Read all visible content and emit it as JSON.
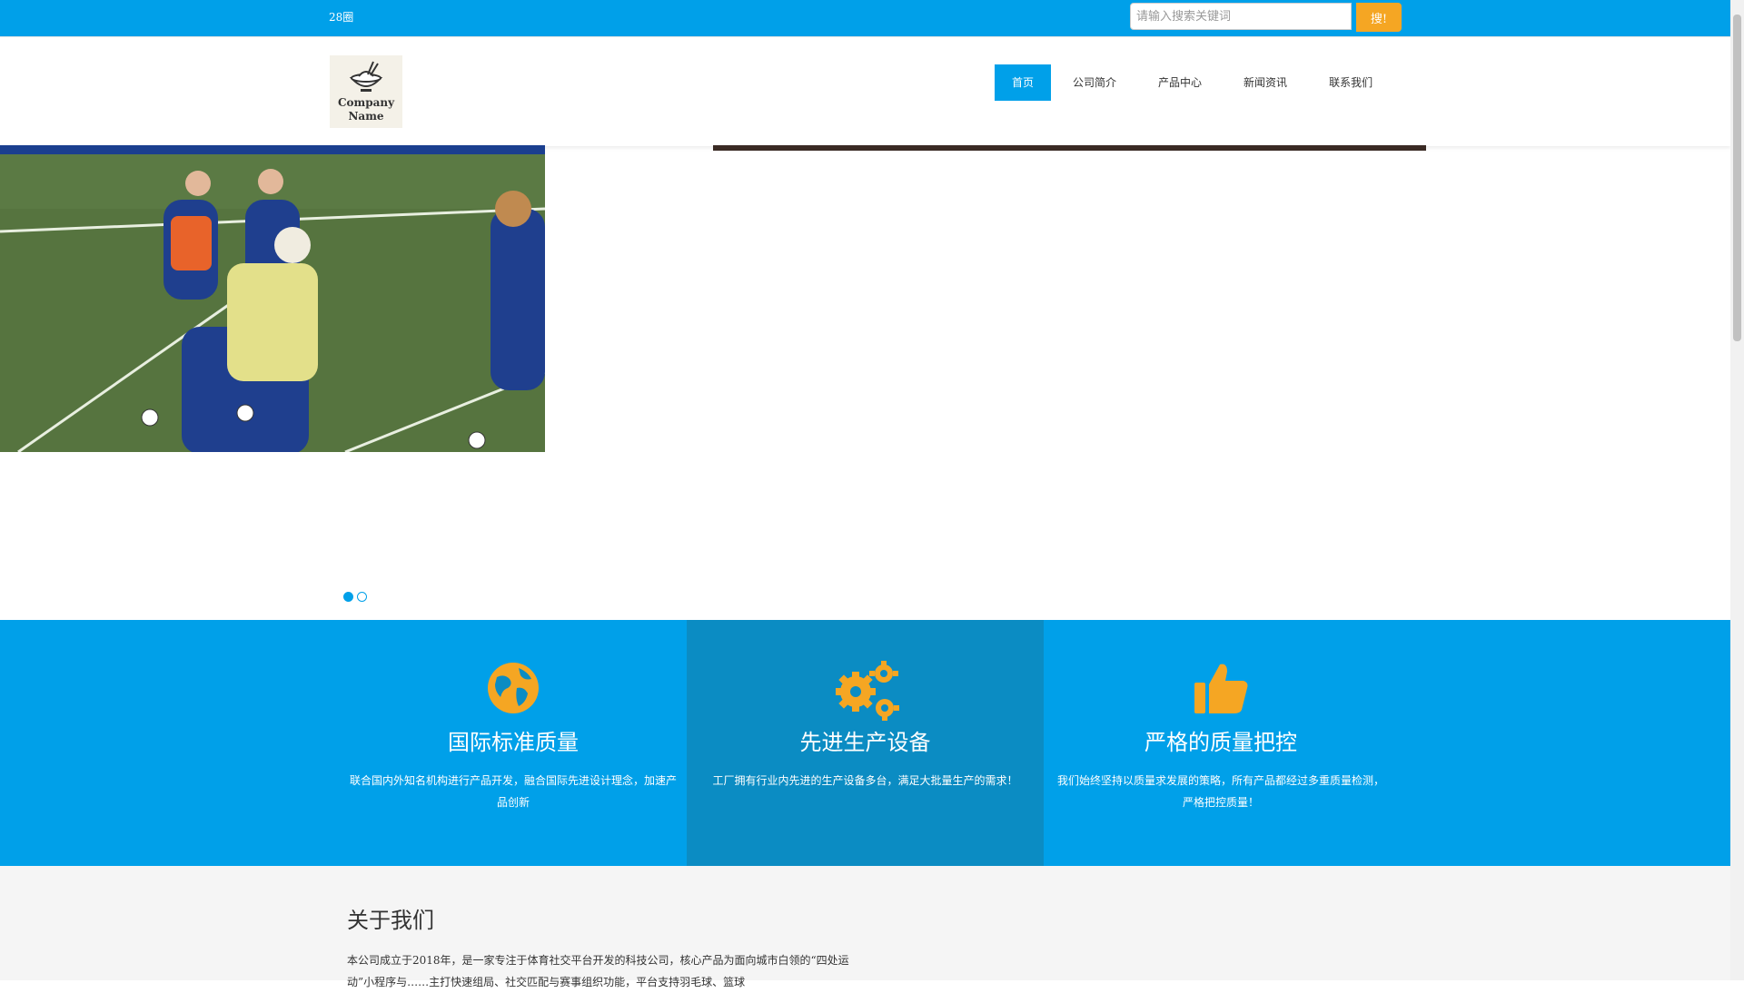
{
  "topbar": {
    "brand": "28圈",
    "search_placeholder": "请输入搜索关键词",
    "search_button": "搜!"
  },
  "logo": {
    "line1": "Company",
    "line2": "Name"
  },
  "nav": {
    "items": [
      "首页",
      "公司简介",
      "产品中心",
      "新闻资讯",
      "联系我们"
    ],
    "active_index": 0
  },
  "carousel": {
    "slide_count": 2,
    "active_slide": 1
  },
  "features": [
    {
      "icon": "globe-icon",
      "title": "国际标准质量",
      "desc": "联合国内外知名机构进行产品开发，融合国际先进设计理念，加速产品创新"
    },
    {
      "icon": "gears-icon",
      "title": "先进生产设备",
      "desc": "工厂拥有行业内先进的生产设备多台，满足大批量生产的需求！"
    },
    {
      "icon": "thumbs-up-icon",
      "title": "严格的质量把控",
      "desc": "我们始终坚持以质量求发展的策略，所有产品都经过多重质量检测，严格把控质量！"
    }
  ],
  "about": {
    "title": "关于我们",
    "text": "本公司成立于2018年，是一家专注于体育社交平台开发的科技公司，核心产品为面向城市白领的“四处运动”小程序与……主打快速组局、社交匹配与赛事组织功能，平台支持羽毛球、篮球"
  },
  "colors": {
    "primary": "#00a0e9",
    "accent": "#f5a623",
    "feature_alt": "#0b8cc3"
  }
}
